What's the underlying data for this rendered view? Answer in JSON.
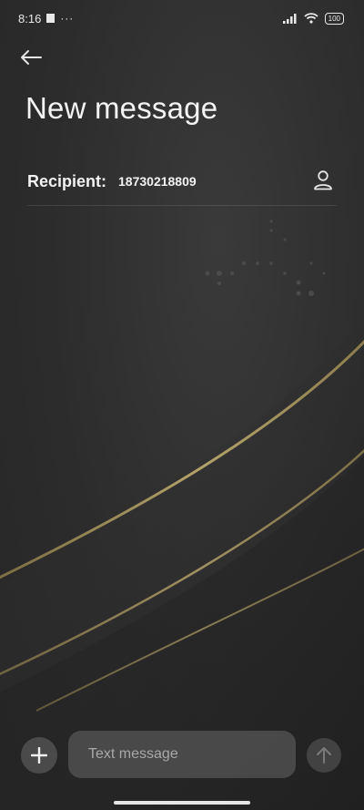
{
  "status_bar": {
    "time": "8:16",
    "extra": "···",
    "battery": "100"
  },
  "header": {
    "back_icon": "arrow-left-icon",
    "title": "New message"
  },
  "recipient": {
    "label": "Recipient:",
    "value": "18730218809",
    "contact_icon": "person-icon"
  },
  "compose": {
    "add_icon": "plus-icon",
    "placeholder": "Text message",
    "send_icon": "arrow-up-icon"
  },
  "colors": {
    "background": "#2f2f2f",
    "gold_curve": "#9c8c5a",
    "input_bg": "#555555"
  }
}
